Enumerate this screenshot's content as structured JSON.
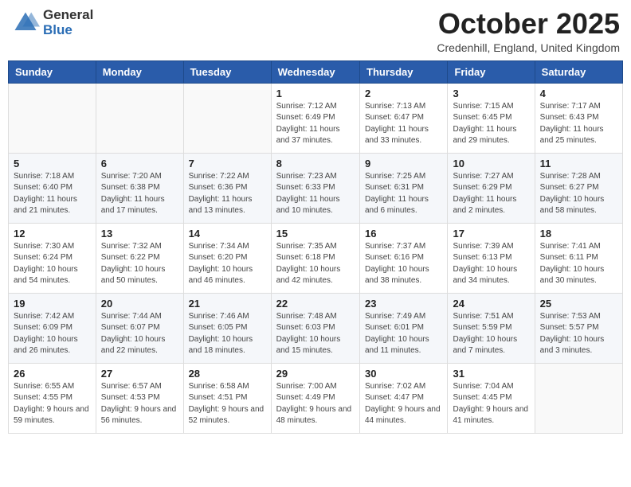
{
  "header": {
    "logo": {
      "general": "General",
      "blue": "Blue"
    },
    "title": "October 2025",
    "location": "Credenhill, England, United Kingdom"
  },
  "calendar": {
    "days_of_week": [
      "Sunday",
      "Monday",
      "Tuesday",
      "Wednesday",
      "Thursday",
      "Friday",
      "Saturday"
    ],
    "weeks": [
      [
        {
          "day": "",
          "sunrise": "",
          "sunset": "",
          "daylight": ""
        },
        {
          "day": "",
          "sunrise": "",
          "sunset": "",
          "daylight": ""
        },
        {
          "day": "",
          "sunrise": "",
          "sunset": "",
          "daylight": ""
        },
        {
          "day": "1",
          "sunrise": "Sunrise: 7:12 AM",
          "sunset": "Sunset: 6:49 PM",
          "daylight": "Daylight: 11 hours and 37 minutes."
        },
        {
          "day": "2",
          "sunrise": "Sunrise: 7:13 AM",
          "sunset": "Sunset: 6:47 PM",
          "daylight": "Daylight: 11 hours and 33 minutes."
        },
        {
          "day": "3",
          "sunrise": "Sunrise: 7:15 AM",
          "sunset": "Sunset: 6:45 PM",
          "daylight": "Daylight: 11 hours and 29 minutes."
        },
        {
          "day": "4",
          "sunrise": "Sunrise: 7:17 AM",
          "sunset": "Sunset: 6:43 PM",
          "daylight": "Daylight: 11 hours and 25 minutes."
        }
      ],
      [
        {
          "day": "5",
          "sunrise": "Sunrise: 7:18 AM",
          "sunset": "Sunset: 6:40 PM",
          "daylight": "Daylight: 11 hours and 21 minutes."
        },
        {
          "day": "6",
          "sunrise": "Sunrise: 7:20 AM",
          "sunset": "Sunset: 6:38 PM",
          "daylight": "Daylight: 11 hours and 17 minutes."
        },
        {
          "day": "7",
          "sunrise": "Sunrise: 7:22 AM",
          "sunset": "Sunset: 6:36 PM",
          "daylight": "Daylight: 11 hours and 13 minutes."
        },
        {
          "day": "8",
          "sunrise": "Sunrise: 7:23 AM",
          "sunset": "Sunset: 6:33 PM",
          "daylight": "Daylight: 11 hours and 10 minutes."
        },
        {
          "day": "9",
          "sunrise": "Sunrise: 7:25 AM",
          "sunset": "Sunset: 6:31 PM",
          "daylight": "Daylight: 11 hours and 6 minutes."
        },
        {
          "day": "10",
          "sunrise": "Sunrise: 7:27 AM",
          "sunset": "Sunset: 6:29 PM",
          "daylight": "Daylight: 11 hours and 2 minutes."
        },
        {
          "day": "11",
          "sunrise": "Sunrise: 7:28 AM",
          "sunset": "Sunset: 6:27 PM",
          "daylight": "Daylight: 10 hours and 58 minutes."
        }
      ],
      [
        {
          "day": "12",
          "sunrise": "Sunrise: 7:30 AM",
          "sunset": "Sunset: 6:24 PM",
          "daylight": "Daylight: 10 hours and 54 minutes."
        },
        {
          "day": "13",
          "sunrise": "Sunrise: 7:32 AM",
          "sunset": "Sunset: 6:22 PM",
          "daylight": "Daylight: 10 hours and 50 minutes."
        },
        {
          "day": "14",
          "sunrise": "Sunrise: 7:34 AM",
          "sunset": "Sunset: 6:20 PM",
          "daylight": "Daylight: 10 hours and 46 minutes."
        },
        {
          "day": "15",
          "sunrise": "Sunrise: 7:35 AM",
          "sunset": "Sunset: 6:18 PM",
          "daylight": "Daylight: 10 hours and 42 minutes."
        },
        {
          "day": "16",
          "sunrise": "Sunrise: 7:37 AM",
          "sunset": "Sunset: 6:16 PM",
          "daylight": "Daylight: 10 hours and 38 minutes."
        },
        {
          "day": "17",
          "sunrise": "Sunrise: 7:39 AM",
          "sunset": "Sunset: 6:13 PM",
          "daylight": "Daylight: 10 hours and 34 minutes."
        },
        {
          "day": "18",
          "sunrise": "Sunrise: 7:41 AM",
          "sunset": "Sunset: 6:11 PM",
          "daylight": "Daylight: 10 hours and 30 minutes."
        }
      ],
      [
        {
          "day": "19",
          "sunrise": "Sunrise: 7:42 AM",
          "sunset": "Sunset: 6:09 PM",
          "daylight": "Daylight: 10 hours and 26 minutes."
        },
        {
          "day": "20",
          "sunrise": "Sunrise: 7:44 AM",
          "sunset": "Sunset: 6:07 PM",
          "daylight": "Daylight: 10 hours and 22 minutes."
        },
        {
          "day": "21",
          "sunrise": "Sunrise: 7:46 AM",
          "sunset": "Sunset: 6:05 PM",
          "daylight": "Daylight: 10 hours and 18 minutes."
        },
        {
          "day": "22",
          "sunrise": "Sunrise: 7:48 AM",
          "sunset": "Sunset: 6:03 PM",
          "daylight": "Daylight: 10 hours and 15 minutes."
        },
        {
          "day": "23",
          "sunrise": "Sunrise: 7:49 AM",
          "sunset": "Sunset: 6:01 PM",
          "daylight": "Daylight: 10 hours and 11 minutes."
        },
        {
          "day": "24",
          "sunrise": "Sunrise: 7:51 AM",
          "sunset": "Sunset: 5:59 PM",
          "daylight": "Daylight: 10 hours and 7 minutes."
        },
        {
          "day": "25",
          "sunrise": "Sunrise: 7:53 AM",
          "sunset": "Sunset: 5:57 PM",
          "daylight": "Daylight: 10 hours and 3 minutes."
        }
      ],
      [
        {
          "day": "26",
          "sunrise": "Sunrise: 6:55 AM",
          "sunset": "Sunset: 4:55 PM",
          "daylight": "Daylight: 9 hours and 59 minutes."
        },
        {
          "day": "27",
          "sunrise": "Sunrise: 6:57 AM",
          "sunset": "Sunset: 4:53 PM",
          "daylight": "Daylight: 9 hours and 56 minutes."
        },
        {
          "day": "28",
          "sunrise": "Sunrise: 6:58 AM",
          "sunset": "Sunset: 4:51 PM",
          "daylight": "Daylight: 9 hours and 52 minutes."
        },
        {
          "day": "29",
          "sunrise": "Sunrise: 7:00 AM",
          "sunset": "Sunset: 4:49 PM",
          "daylight": "Daylight: 9 hours and 48 minutes."
        },
        {
          "day": "30",
          "sunrise": "Sunrise: 7:02 AM",
          "sunset": "Sunset: 4:47 PM",
          "daylight": "Daylight: 9 hours and 44 minutes."
        },
        {
          "day": "31",
          "sunrise": "Sunrise: 7:04 AM",
          "sunset": "Sunset: 4:45 PM",
          "daylight": "Daylight: 9 hours and 41 minutes."
        },
        {
          "day": "",
          "sunrise": "",
          "sunset": "",
          "daylight": ""
        }
      ]
    ]
  }
}
